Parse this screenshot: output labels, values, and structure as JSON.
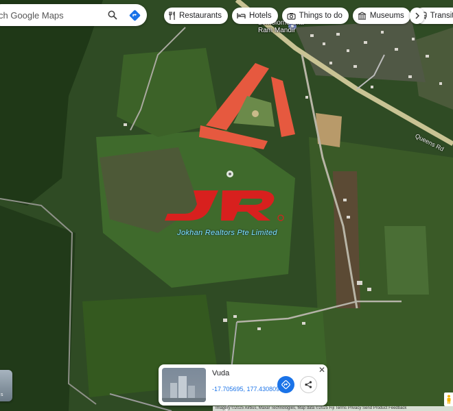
{
  "search": {
    "placeholder": "ch Google Maps"
  },
  "chips": [
    {
      "label": "Restaurants",
      "icon": "fork-knife-icon"
    },
    {
      "label": "Hotels",
      "icon": "bed-icon"
    },
    {
      "label": "Things to do",
      "icon": "camera-icon"
    },
    {
      "label": "Museums",
      "icon": "museum-icon"
    },
    {
      "label": "Transit",
      "icon": "transit-icon"
    }
  ],
  "map": {
    "place_label_line1": "Lomolomo Sita",
    "place_label_line2": "Ram Mandir",
    "road_label": "Queens Rd",
    "brand_logo_text": "JR",
    "brand_tagline": "Jokhan Realtors Pte Limited"
  },
  "card": {
    "title": "Vuda",
    "coords": "-17.705695, 177.430809",
    "thumb_label": "Streetview image"
  },
  "street_view_thumb": {
    "label": "s"
  },
  "footer": {
    "text": "Imagery ©2025 Airbus, Maxar Technologies, Map data ©2025    Fiji    Terms    Privacy    Send Product Feedback"
  },
  "colors": {
    "brand_red": "#d8201e",
    "accent_blue": "#1a73e8",
    "tagline_cyan": "#7de3ff"
  }
}
